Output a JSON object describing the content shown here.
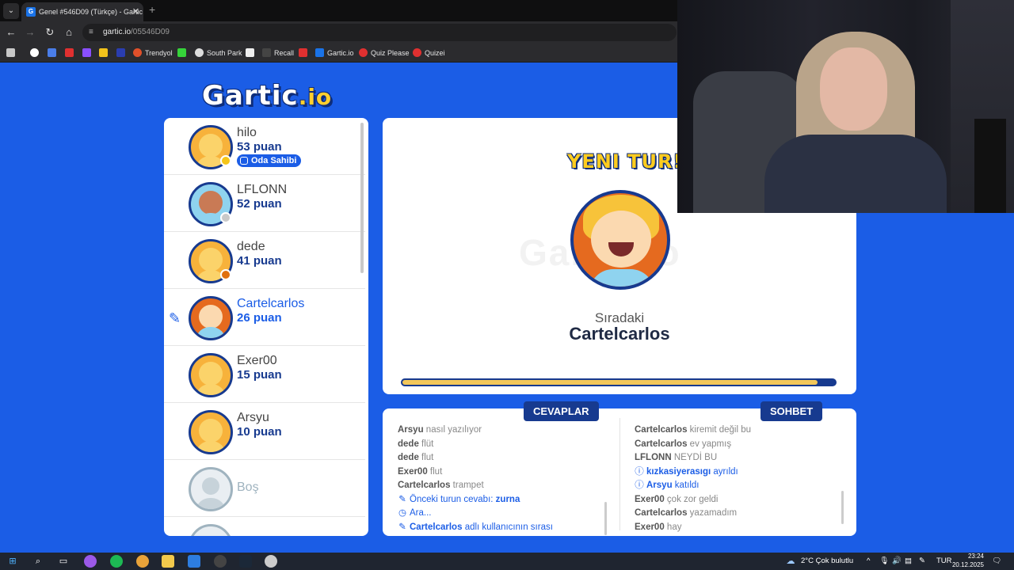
{
  "browser": {
    "tab_title": "Genel #546D09 (Türkçe) - Gartic",
    "tab_favicon": "G",
    "url_host": "gartic.io",
    "url_path": "/05546D09",
    "bookmarks": [
      "Trendyol",
      "South Park",
      "Recall",
      "Gartic.io",
      "Quiz Please",
      "Quizei"
    ]
  },
  "game": {
    "logo_main": "Gartic",
    "logo_suffix": ".io",
    "round_banner": "YENI TUR!",
    "watermark": "Gartic.io",
    "next_label": "Sıradaki",
    "next_player": "Cartelcarlos",
    "timer_fraction": 0.96,
    "owner_badge": "Oda Sahibi",
    "players": [
      {
        "name": "hilo",
        "points": "53 puan",
        "status_color": "#f5c518",
        "owner": true,
        "active": false
      },
      {
        "name": "LFLONN",
        "points": "52 puan",
        "status_color": "#c9c9c9",
        "owner": false,
        "active": false
      },
      {
        "name": "dede",
        "points": "41 puan",
        "status_color": "#e0700f",
        "owner": false,
        "active": false
      },
      {
        "name": "Cartelcarlos",
        "points": "26 puan",
        "status_color": "",
        "owner": false,
        "active": true
      },
      {
        "name": "Exer00",
        "points": "15 puan",
        "status_color": "",
        "owner": false,
        "active": false
      },
      {
        "name": "Arsyu",
        "points": "10 puan",
        "status_color": "",
        "owner": false,
        "active": false
      }
    ],
    "empty_slot_label": "Boş"
  },
  "answers": {
    "tab_label": "CEVAPLAR",
    "messages": [
      {
        "user": "Arsyu",
        "text": "nasıl yazılıyor"
      },
      {
        "user": "dede",
        "text": "flüt"
      },
      {
        "user": "dede",
        "text": "flut"
      },
      {
        "user": "Exer00",
        "text": "flut"
      },
      {
        "user": "Cartelcarlos",
        "text": "trampet"
      },
      {
        "system": true,
        "icon": "pencil-icon",
        "text": "Önceki turun cevabı:",
        "bold": "zurna"
      },
      {
        "system": true,
        "icon": "clock-icon",
        "text": "Ara..."
      },
      {
        "system": true,
        "icon": "pencil-icon",
        "bold_first": "Cartelcarlos",
        "text": "adlı kullanıcının sırası"
      }
    ]
  },
  "chat": {
    "tab_label": "SOHBET",
    "messages": [
      {
        "user": "Cartelcarlos",
        "text": "kiremit değil bu"
      },
      {
        "user": "Cartelcarlos",
        "text": "ev yapmış"
      },
      {
        "user": "LFLONN",
        "text": "NEYDİ BU"
      },
      {
        "system": true,
        "icon": "info-icon",
        "bold_first": "kızkasiyerasıgı",
        "text": "ayrıldı"
      },
      {
        "system": true,
        "icon": "info-icon",
        "bold_first": "Arsyu",
        "text": "katıldı"
      },
      {
        "user": "Exer00",
        "text": "çok zor geldi"
      },
      {
        "user": "Cartelcarlos",
        "text": "yazamadım"
      },
      {
        "user": "Exer00",
        "text": "hay"
      }
    ]
  },
  "taskbar": {
    "weather": "2°C  Çok bulutlu",
    "lang": "TUR",
    "time": "23:24",
    "date": "20.12.2025"
  },
  "colors": {
    "background": "#1b5de6",
    "navy": "#173a8f",
    "accent_yellow": "#ffcc1f"
  }
}
